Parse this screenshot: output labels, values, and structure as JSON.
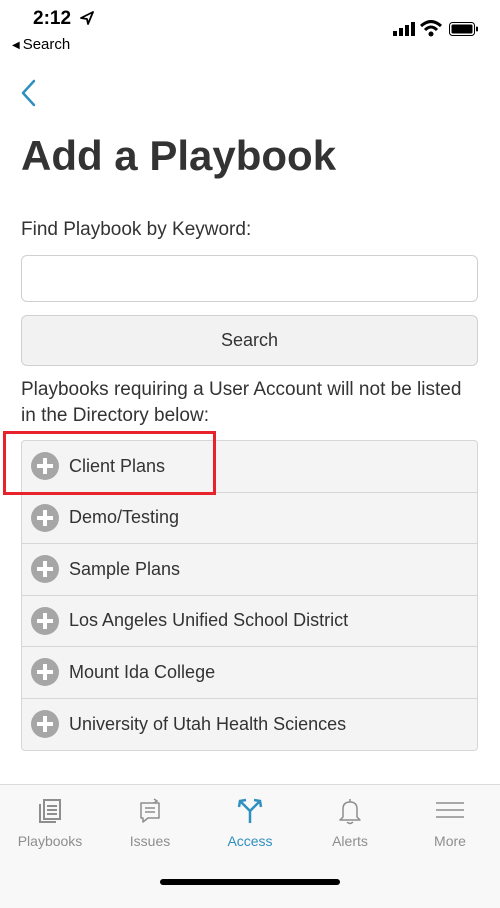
{
  "status_bar": {
    "time": "2:12",
    "back_app_label": "Search"
  },
  "page": {
    "title": "Add a Playbook",
    "keyword_label": "Find Playbook by Keyword:",
    "search_value": "",
    "search_button": "Search",
    "notice": "Playbooks requiring a User Account will not be listed in the Directory below:"
  },
  "directory": {
    "items": [
      {
        "label": "Client Plans"
      },
      {
        "label": "Demo/Testing"
      },
      {
        "label": "Sample Plans"
      },
      {
        "label": "Los Angeles Unified School District"
      },
      {
        "label": "Mount Ida College"
      },
      {
        "label": "University of Utah Health Sciences"
      }
    ]
  },
  "tab_bar": {
    "tabs": [
      {
        "label": "Playbooks",
        "icon": "playbooks-icon"
      },
      {
        "label": "Issues",
        "icon": "issues-icon"
      },
      {
        "label": "Access",
        "icon": "access-icon",
        "active": true
      },
      {
        "label": "Alerts",
        "icon": "bell-icon"
      },
      {
        "label": "More",
        "icon": "menu-icon"
      }
    ]
  },
  "colors": {
    "accent": "#2f8fbf",
    "highlight": "#e8222b",
    "inactive": "#8e8e8e"
  }
}
